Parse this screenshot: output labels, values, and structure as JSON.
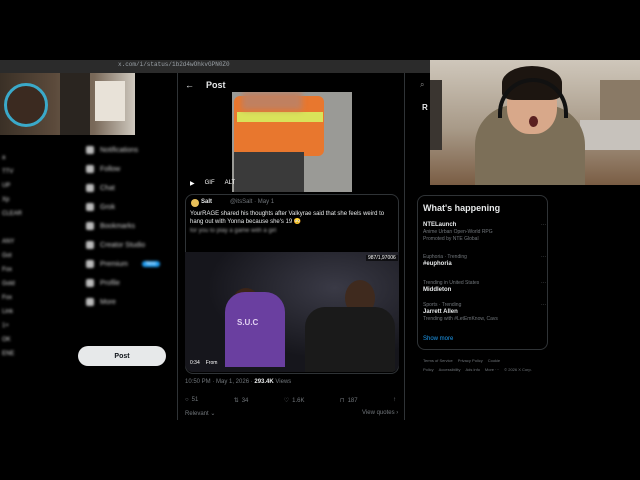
{
  "browser": {
    "url": "x.com/i/status/1b2d4wOhkvGPN0Z0"
  },
  "left_chat": {
    "lines": [
      "",
      "a",
      "TTV",
      "UP",
      "Xp",
      "CLEAR",
      "",
      "ANY",
      "Got",
      "Fox",
      "Gold",
      "Fox",
      "Link",
      "1+",
      "OK",
      "ENE"
    ]
  },
  "sidebar": {
    "items": [
      "Notifications",
      "Follow",
      "Chat",
      "Grok",
      "Bookmarks",
      "Creator Studio",
      "Premium",
      "Profile",
      "More"
    ],
    "premium_badge": "New",
    "post_button": "Post"
  },
  "post": {
    "back": "←",
    "title": "Post",
    "media1_controls": [
      "▶",
      "GIF",
      "ALT"
    ],
    "quote": {
      "author": "Salt",
      "handle": "@itsSalt · May 1",
      "text": "YourRAGE shared his thoughts after Valkyrae said that she feels weird to hang out with Yonna because she's 19 😳",
      "blurred_text": "for you to play a game with a girl"
    },
    "media2_count": "987/1,97006",
    "media2_time": "0:34",
    "media2_from": "From",
    "tshirt": "S.U.C",
    "timestamp": "10:50 PM · May 1, 2026 · ",
    "views_count": "293.4K",
    "views_label": "Views",
    "actions": [
      {
        "icon": "reply-icon",
        "glyph": "○",
        "count": "51"
      },
      {
        "icon": "repost-icon",
        "glyph": "⇅",
        "count": "34"
      },
      {
        "icon": "like-icon",
        "glyph": "♡",
        "count": "1.6K"
      },
      {
        "icon": "bookmark-icon",
        "glyph": "⊓",
        "count": "187"
      },
      {
        "icon": "share-icon",
        "glyph": "↑",
        "count": ""
      }
    ],
    "relevant": "Relevant ⌄",
    "view_quotes": "View quotes ›"
  },
  "right": {
    "search_glyph": "⌕",
    "letter": "R",
    "happening_title": "What's happening",
    "trends": [
      {
        "sub": "",
        "title": "NTELaunch",
        "desc": "Anime Urban Open-World RPG",
        "desc2": "Promoted by NTE Global"
      },
      {
        "sub": "Euphoria · Trending",
        "title": "#euphoria",
        "desc": "",
        "desc2": ""
      },
      {
        "sub": "Trending in United States",
        "title": "Middleton",
        "desc": "",
        "desc2": ""
      },
      {
        "sub": "Sports · Trending",
        "title": "Jarrett Allen",
        "desc": "Trending with #LetEmKnow, Cavs",
        "desc2": ""
      }
    ],
    "show_more": "Show more",
    "footer": [
      "Terms of Service",
      "Privacy Policy",
      "Cookie Policy",
      "Accessibility",
      "Ads info",
      "More ···",
      "© 2026 X Corp."
    ]
  },
  "colors": {
    "accent": "#1d9bf0",
    "background": "#000000",
    "border": "#2f3336"
  }
}
